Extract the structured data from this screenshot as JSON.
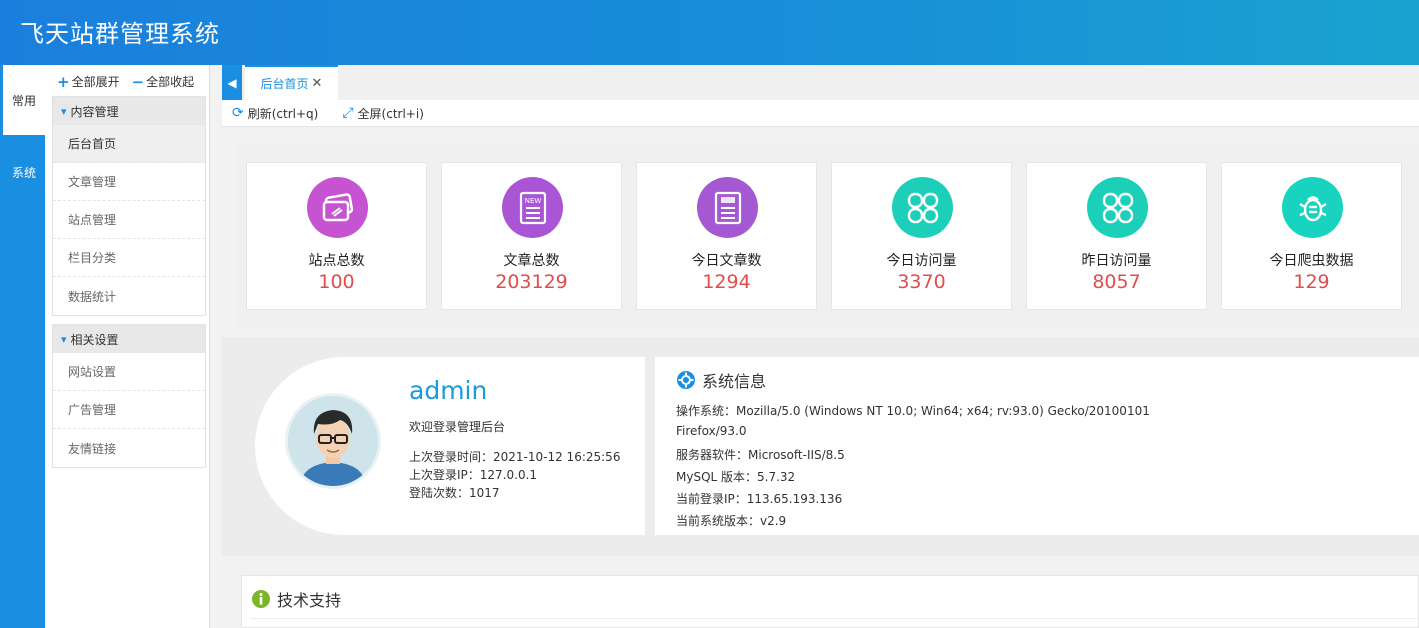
{
  "app": {
    "title": "飞天站群管理系统"
  },
  "rail": {
    "tabs": [
      "常用",
      "系统"
    ]
  },
  "sidebar": {
    "expand_all": "全部展开",
    "collapse_all": "全部收起",
    "groups": [
      {
        "title": "内容管理",
        "items": [
          "后台首页",
          "文章管理",
          "站点管理",
          "栏目分类",
          "数据统计"
        ]
      },
      {
        "title": "相关设置",
        "items": [
          "网站设置",
          "广告管理",
          "友情链接"
        ]
      }
    ]
  },
  "tabs": {
    "active": "后台首页"
  },
  "toolbar": {
    "refresh": "刷新(ctrl+q)",
    "fullscreen": "全屏(ctrl+i)"
  },
  "stats": [
    {
      "label": "站点总数",
      "value": "100",
      "icon": "cards-icon",
      "color": "#c553d2"
    },
    {
      "label": "文章总数",
      "value": "203129",
      "icon": "news-icon",
      "color": "#a955d6"
    },
    {
      "label": "今日文章数",
      "value": "1294",
      "icon": "today-doc-icon",
      "color": "#a458d2"
    },
    {
      "label": "今日访问量",
      "value": "3370",
      "icon": "clover-icon",
      "color": "#1ccfb8"
    },
    {
      "label": "昨日访问量",
      "value": "8057",
      "icon": "clover-icon",
      "color": "#1ccfb8"
    },
    {
      "label": "今日爬虫数据",
      "value": "129",
      "icon": "bug-icon",
      "color": "#18d4bf"
    }
  ],
  "profile": {
    "username": "admin",
    "welcome": "欢迎登录管理后台",
    "last_login_time": "上次登录时间：2021-10-12 16:25:56",
    "last_login_ip": "上次登录IP：127.0.0.1",
    "login_count": "登陆次数：1017"
  },
  "system": {
    "title": "系统信息",
    "os_line1": "操作系统：Mozilla/5.0 (Windows NT 10.0; Win64; x64; rv:93.0) Gecko/20100101",
    "os_line2": "Firefox/93.0",
    "server": "服务器软件：Microsoft-IIS/8.5",
    "mysql": "MySQL 版本：5.7.32",
    "login_ip": "当前登录IP：113.65.193.136",
    "version": "当前系统版本：v2.9"
  },
  "support": {
    "title": "技术支持"
  },
  "colors": {
    "accent": "#1a8ee0",
    "value_red": "#e04d4d",
    "username_blue": "#1a9be0"
  }
}
